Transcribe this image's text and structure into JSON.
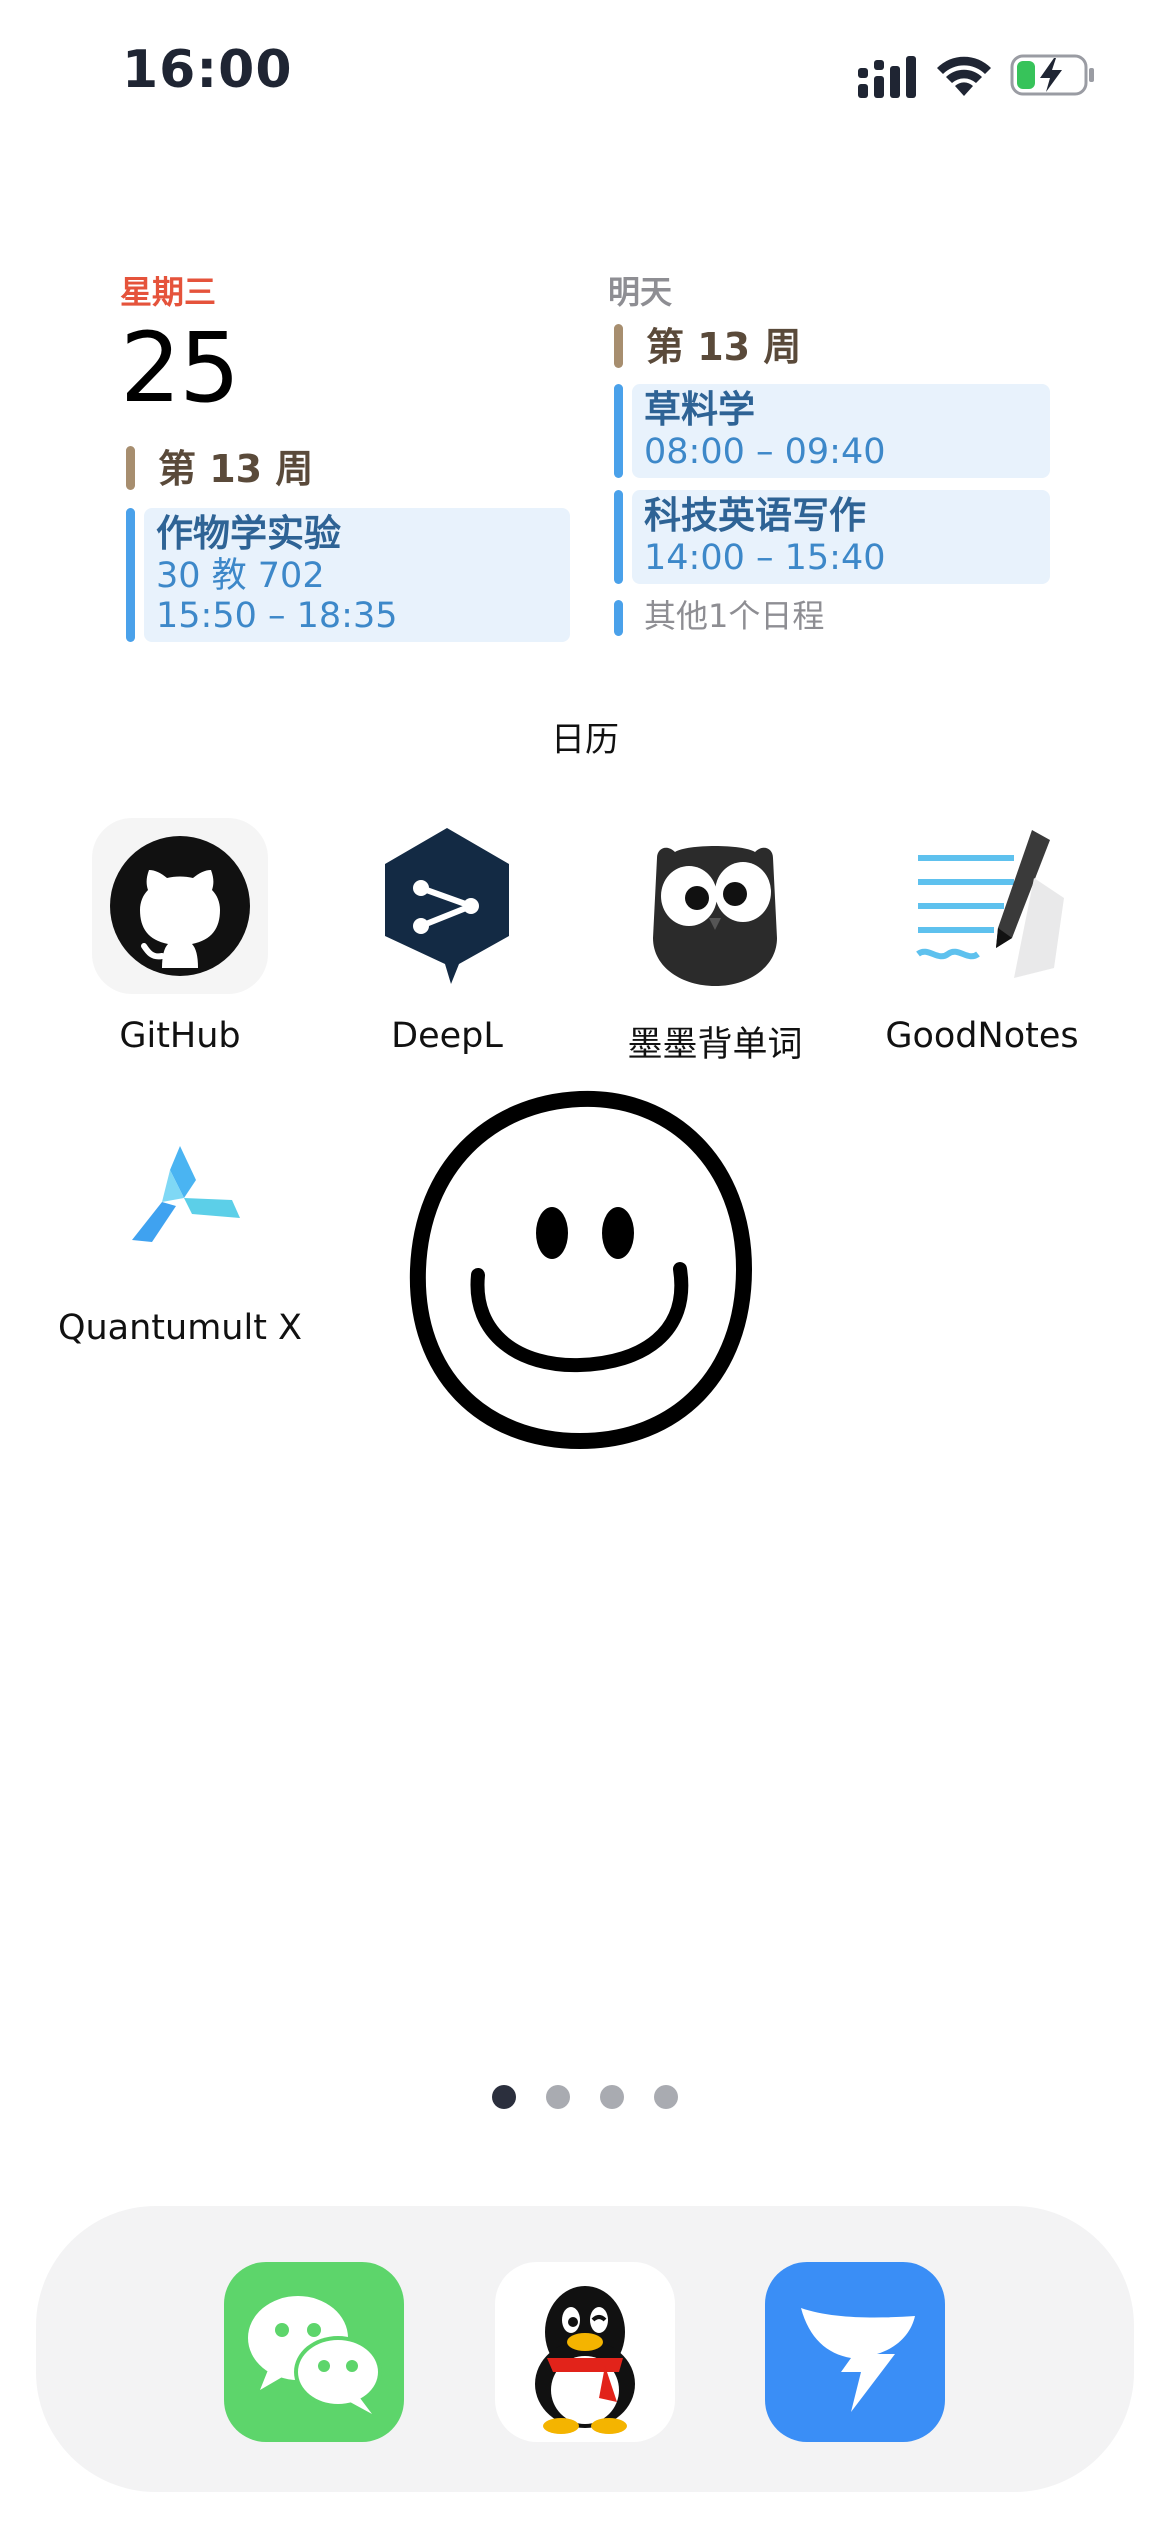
{
  "status_bar": {
    "time": "16:00",
    "icons": [
      "cellular-signal-icon",
      "wifi-icon",
      "battery-charging-icon"
    ]
  },
  "calendar_widget": {
    "today": {
      "weekday": "星期三",
      "date": "25",
      "week": "第 13 周",
      "events": [
        {
          "title": "作物学实验",
          "location": "30 教 702",
          "time": "15:50 – 18:35"
        }
      ]
    },
    "tomorrow": {
      "label": "明天",
      "week": "第 13 周",
      "events": [
        {
          "title": "草料学",
          "time": "08:00 – 09:40"
        },
        {
          "title": "科技英语写作",
          "time": "14:00 – 15:40"
        }
      ],
      "more": "其他1个日程"
    },
    "widget_name": "日历"
  },
  "apps": [
    {
      "label": "GitHub",
      "icon": "github-icon"
    },
    {
      "label": "DeepL",
      "icon": "deepl-icon"
    },
    {
      "label": "墨墨背单词",
      "icon": "momo-owl-icon"
    },
    {
      "label": "GoodNotes",
      "icon": "goodnotes-icon"
    },
    {
      "label": "Quantumult X",
      "icon": "quantumult-icon"
    }
  ],
  "smiley": {
    "icon": "smiley-face-icon"
  },
  "page_dots": {
    "count": 4,
    "active": 1
  },
  "dock": [
    {
      "icon": "wechat-icon",
      "color": "#5dd56b"
    },
    {
      "icon": "qq-penguin-icon",
      "color": "#ffffff"
    },
    {
      "icon": "dingtalk-icon",
      "color": "#3a8ef6"
    }
  ],
  "colors": {
    "weekday_red": "#e5533b",
    "event_blue": "#4aa1ea",
    "event_bg": "#e8f2fc",
    "week_bar": "#a78e6f"
  }
}
